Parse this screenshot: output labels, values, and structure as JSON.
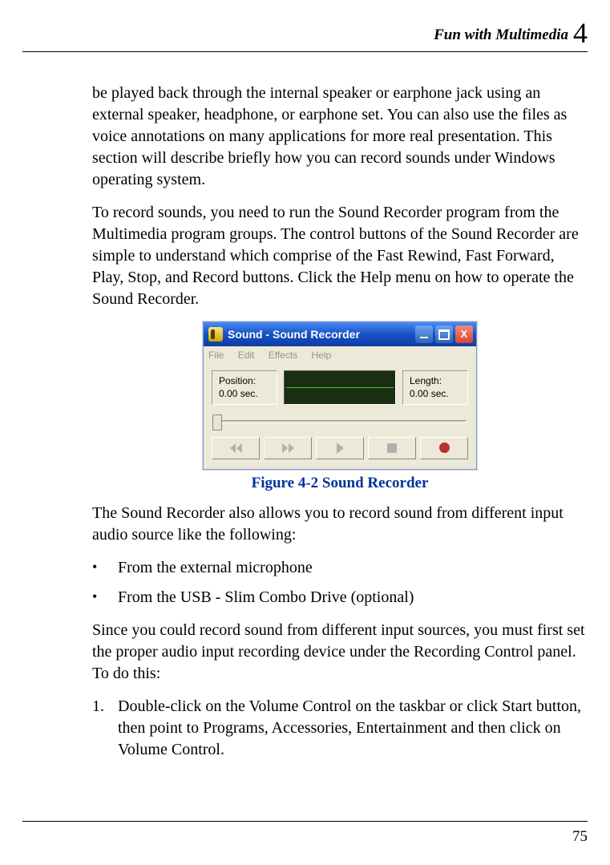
{
  "header": {
    "title": "Fun with Multimedia",
    "chapter_num": "4"
  },
  "paragraphs": {
    "p1": "be played back through the internal speaker or earphone jack using an external speaker, headphone, or earphone set. You can also use the files as voice annotations on many applications for more real presentation. This section will describe briefly how you can record sounds under Windows operating system.",
    "p2": "To record sounds, you need to run the Sound Recorder program from the Multimedia program groups. The control buttons of the Sound Recorder are simple to understand which comprise of the Fast Rewind, Fast Forward, Play, Stop, and Record buttons. Click the Help menu on how to operate the Sound Recorder.",
    "p3": "The Sound Recorder also allows you to record sound from different input audio source like the following:",
    "p4": "Since you could record sound from different input sources, you must first set the proper audio input recording device under the Recording Control panel. To do this:"
  },
  "bullets": [
    "From the external microphone",
    "From the USB - Slim Combo Drive (optional)"
  ],
  "steps": [
    {
      "num": "1.",
      "text": "Double-click on the Volume Control on the taskbar or click Start button, then point to Programs, Accessories, Entertainment and then click on Volume Control."
    }
  ],
  "figure": {
    "caption": "Figure 4-2    Sound Recorder",
    "window_title": "Sound - Sound Recorder",
    "menu": [
      "File",
      "Edit",
      "Effects",
      "Help"
    ],
    "position_label": "Position:",
    "position_value": "0.00 sec.",
    "length_label": "Length:",
    "length_value": "0.00 sec.",
    "close_glyph": "X"
  },
  "page_number": "75",
  "chart_data": null
}
